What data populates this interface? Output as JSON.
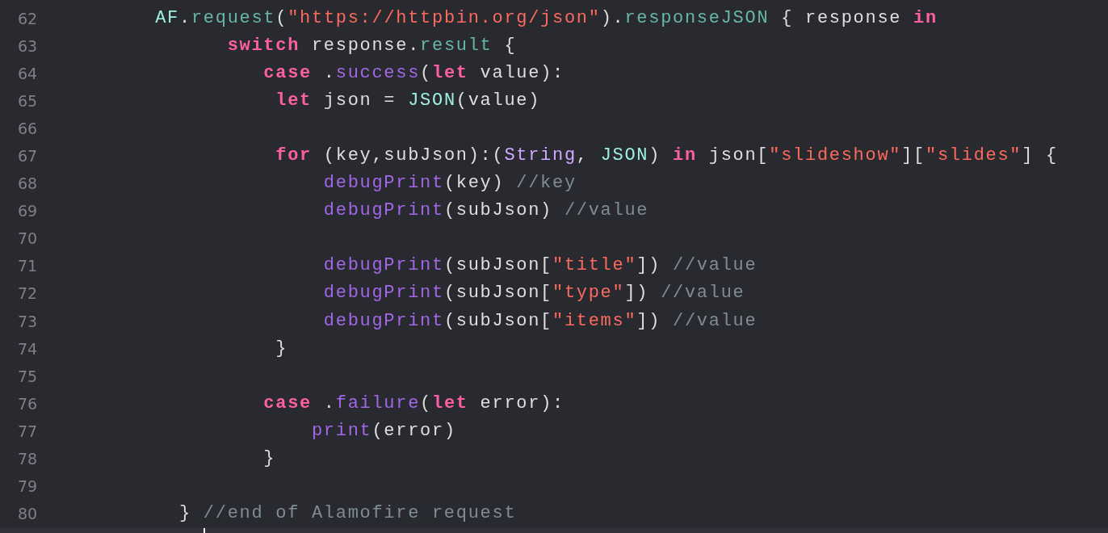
{
  "editor": {
    "lines": [
      {
        "number": "62",
        "tokens": [
          {
            "kind": "class",
            "text": "        AF"
          },
          {
            "kind": "plain",
            "text": "."
          },
          {
            "kind": "property",
            "text": "request"
          },
          {
            "kind": "plain",
            "text": "("
          },
          {
            "kind": "string",
            "text": "\"https://httpbin.org/json\""
          },
          {
            "kind": "plain",
            "text": ")."
          },
          {
            "kind": "property",
            "text": "responseJSON"
          },
          {
            "kind": "plain",
            "text": " { response "
          },
          {
            "kind": "keyword",
            "text": "in"
          }
        ]
      },
      {
        "number": "63",
        "tokens": [
          {
            "kind": "keyword",
            "text": "              switch"
          },
          {
            "kind": "plain",
            "text": " response."
          },
          {
            "kind": "property",
            "text": "result"
          },
          {
            "kind": "plain",
            "text": " {"
          }
        ]
      },
      {
        "number": "64",
        "tokens": [
          {
            "kind": "keyword",
            "text": "                 case"
          },
          {
            "kind": "plain",
            "text": " ."
          },
          {
            "kind": "func",
            "text": "success"
          },
          {
            "kind": "plain",
            "text": "("
          },
          {
            "kind": "keyword",
            "text": "let"
          },
          {
            "kind": "plain",
            "text": " value):"
          }
        ]
      },
      {
        "number": "65",
        "tokens": [
          {
            "kind": "keyword",
            "text": "                  let"
          },
          {
            "kind": "plain",
            "text": " json = "
          },
          {
            "kind": "class",
            "text": "JSON"
          },
          {
            "kind": "plain",
            "text": "(value)"
          }
        ]
      },
      {
        "number": "66"
      },
      {
        "number": "67",
        "tokens": [
          {
            "kind": "keyword",
            "text": "                  for"
          },
          {
            "kind": "plain",
            "text": " (key,subJson):("
          },
          {
            "kind": "type",
            "text": "String"
          },
          {
            "kind": "plain",
            "text": ", "
          },
          {
            "kind": "class",
            "text": "JSON"
          },
          {
            "kind": "plain",
            "text": ") "
          },
          {
            "kind": "keyword",
            "text": "in"
          },
          {
            "kind": "plain",
            "text": " json["
          },
          {
            "kind": "string",
            "text": "\"slideshow\""
          },
          {
            "kind": "plain",
            "text": "]["
          },
          {
            "kind": "string",
            "text": "\"slides\""
          },
          {
            "kind": "plain",
            "text": "] {"
          }
        ]
      },
      {
        "number": "68",
        "tokens": [
          {
            "kind": "func",
            "text": "                      debugPrint"
          },
          {
            "kind": "plain",
            "text": "(key) "
          },
          {
            "kind": "comment",
            "text": "//key"
          }
        ]
      },
      {
        "number": "69",
        "tokens": [
          {
            "kind": "func",
            "text": "                      debugPrint"
          },
          {
            "kind": "plain",
            "text": "(subJson) "
          },
          {
            "kind": "comment",
            "text": "//value"
          }
        ]
      },
      {
        "number": "70"
      },
      {
        "number": "71",
        "tokens": [
          {
            "kind": "func",
            "text": "                      debugPrint"
          },
          {
            "kind": "plain",
            "text": "(subJson["
          },
          {
            "kind": "string",
            "text": "\"title\""
          },
          {
            "kind": "plain",
            "text": "]) "
          },
          {
            "kind": "comment",
            "text": "//value"
          }
        ]
      },
      {
        "number": "72",
        "tokens": [
          {
            "kind": "func",
            "text": "                      debugPrint"
          },
          {
            "kind": "plain",
            "text": "(subJson["
          },
          {
            "kind": "string",
            "text": "\"type\""
          },
          {
            "kind": "plain",
            "text": "]) "
          },
          {
            "kind": "comment",
            "text": "//value"
          }
        ]
      },
      {
        "number": "73",
        "tokens": [
          {
            "kind": "func",
            "text": "                      debugPrint"
          },
          {
            "kind": "plain",
            "text": "(subJson["
          },
          {
            "kind": "string",
            "text": "\"items\""
          },
          {
            "kind": "plain",
            "text": "]) "
          },
          {
            "kind": "comment",
            "text": "//value"
          }
        ]
      },
      {
        "number": "74",
        "tokens": [
          {
            "kind": "plain",
            "text": "                  }"
          }
        ]
      },
      {
        "number": "75"
      },
      {
        "number": "76",
        "tokens": [
          {
            "kind": "keyword",
            "text": "                 case"
          },
          {
            "kind": "plain",
            "text": " ."
          },
          {
            "kind": "func",
            "text": "failure"
          },
          {
            "kind": "plain",
            "text": "("
          },
          {
            "kind": "keyword",
            "text": "let"
          },
          {
            "kind": "plain",
            "text": " error):"
          }
        ]
      },
      {
        "number": "77",
        "tokens": [
          {
            "kind": "func",
            "text": "                     print"
          },
          {
            "kind": "plain",
            "text": "(error)"
          }
        ]
      },
      {
        "number": "78",
        "tokens": [
          {
            "kind": "plain",
            "text": "                 }"
          }
        ]
      },
      {
        "number": "79"
      },
      {
        "number": "80",
        "tokens": [
          {
            "kind": "plain",
            "text": "          } "
          },
          {
            "kind": "comment",
            "text": "//end of Alamofire request"
          }
        ]
      }
    ]
  }
}
